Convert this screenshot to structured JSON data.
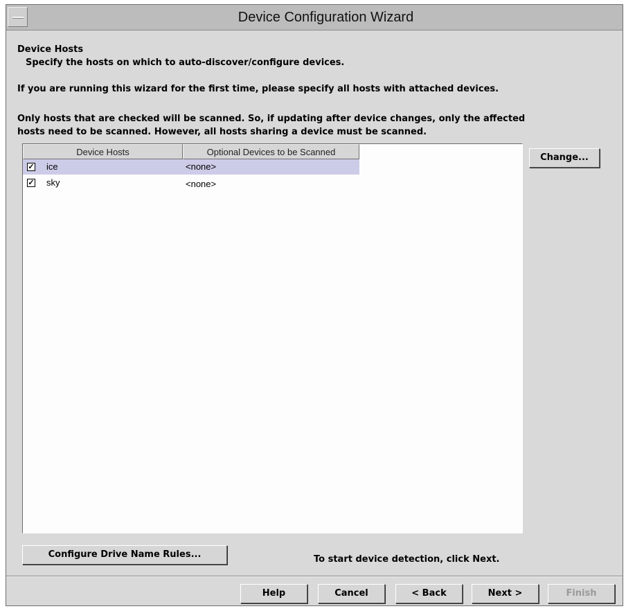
{
  "window": {
    "title": "Device Configuration Wizard"
  },
  "page": {
    "heading": "Device Hosts",
    "description": "Specify the hosts on which to auto-discover/configure devices.",
    "first_time_note": "If you are running this wizard for the first time, please specify all hosts with attached devices.",
    "only_hosts_line1": "Only hosts that are checked will be scanned.  So, if updating after device changes, only the affected",
    "only_hosts_line2": "hosts need to be scanned.  However, all hosts sharing a device must be scanned."
  },
  "table": {
    "columns": [
      "Device Hosts",
      "Optional Devices to be Scanned"
    ],
    "rows": [
      {
        "checked": true,
        "host": "ice",
        "devices": "<none>",
        "selected": true
      },
      {
        "checked": true,
        "host": "sky",
        "devices": "<none>",
        "selected": false
      }
    ]
  },
  "buttons": {
    "change": "Change...",
    "configure_drive": "Configure Drive Name Rules...",
    "help": "Help",
    "cancel": "Cancel",
    "back": "< Back",
    "next": "Next >",
    "finish": "Finish"
  },
  "hint": "To start device detection, click Next.",
  "colors": {
    "selection": "#cccce9",
    "window_bg": "#d9d9d9"
  }
}
